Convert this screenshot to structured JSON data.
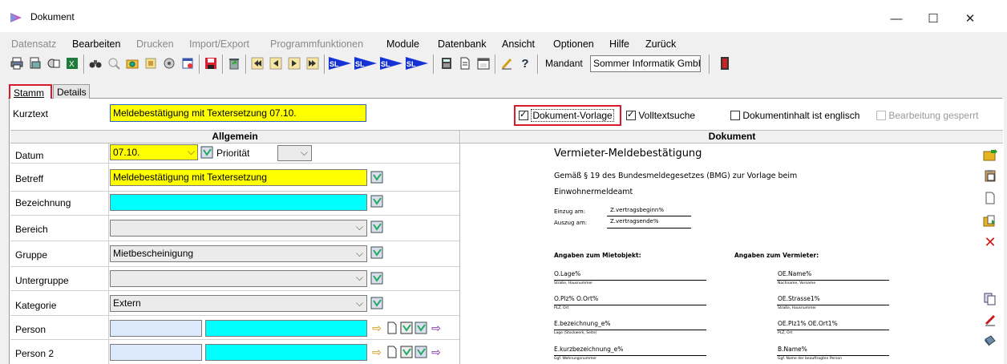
{
  "window": {
    "title": "Dokument",
    "minimize": "—",
    "maximize": "☐",
    "close": "✕"
  },
  "menu": [
    {
      "label": "Datensatz",
      "enabled": false
    },
    {
      "label": "Bearbeiten",
      "enabled": true
    },
    {
      "label": "Drucken",
      "enabled": false
    },
    {
      "label": "Import/Export",
      "enabled": false
    },
    {
      "label": "Programmfunktionen",
      "enabled": false
    },
    {
      "label": "Module",
      "enabled": true
    },
    {
      "label": "Datenbank",
      "enabled": true
    },
    {
      "label": "Ansicht",
      "enabled": true
    },
    {
      "label": "Optionen",
      "enabled": true
    },
    {
      "label": "Hilfe",
      "enabled": true
    },
    {
      "label": "Zurück",
      "enabled": true
    }
  ],
  "toolbar": {
    "mandant_label": "Mandant",
    "mandant_value": "Sommer Informatik GmbH",
    "icons": [
      "print-icon",
      "print-preview-icon",
      "report-icon",
      "excel-icon",
      "binoculars-icon",
      "zoom-icon",
      "search-folder-icon",
      "find-icon",
      "refresh-icon",
      "notes-icon",
      "save-icon",
      "delete-icon",
      "first-record-icon",
      "previous-record-icon",
      "next-record-icon",
      "last-record-icon",
      "sl-blue-1-icon",
      "sl-blue-2-icon",
      "sl-blue-3-icon",
      "sl-blue-4-icon",
      "calculator-icon",
      "document-icon",
      "calendar-icon",
      "edit-icon",
      "help-icon",
      "exit-icon"
    ],
    "sl_label": "SL"
  },
  "tabs": [
    {
      "label": "Stamm",
      "active": true
    },
    {
      "label": "Details",
      "active": false
    }
  ],
  "kurztext": {
    "label": "Kurztext",
    "value": "Meldebestätigung mit Textersetzung  07.10."
  },
  "options": {
    "vorlage": {
      "label": "Dokument-Vorlage",
      "checked": true
    },
    "volltext": {
      "label": "Volltextsuche",
      "checked": true
    },
    "englisch": {
      "label": "Dokumentinhalt ist englisch",
      "checked": false
    },
    "gesperrt": {
      "label": "Bearbeitung gesperrt",
      "checked": false
    }
  },
  "allgemein": {
    "header": "Allgemein",
    "datum": {
      "label": "Datum",
      "value": "07.10.",
      "prio_label": "Priorität"
    },
    "betreff": {
      "label": "Betreff",
      "value": "Meldebestätigung mit Textersetzung"
    },
    "bezeichnung": {
      "label": "Bezeichnung",
      "value": ""
    },
    "bereich": {
      "label": "Bereich",
      "value": ""
    },
    "gruppe": {
      "label": "Gruppe",
      "value": "Mietbescheinigung"
    },
    "untergruppe": {
      "label": "Untergruppe",
      "value": ""
    },
    "kategorie": {
      "label": "Kategorie",
      "value": "Extern"
    },
    "person": {
      "label": "Person"
    },
    "person2": {
      "label": "Person 2"
    }
  },
  "dokument": {
    "header": "Dokument",
    "title": "Vermieter-Meldebestätigung",
    "intro_1": "Gemäß § 19 des Bundesmeldegesetzes (BMG) zur Vorlage beim",
    "intro_2": "Einwohnermeldeamt",
    "einzug_label": "Einzug am:",
    "einzug_value": "Z.vertragsbeginn%",
    "auszug_label": "Auszug am:",
    "auszug_value": "Z.vertragsende%",
    "mietobjekt_heading": "Angaben zum Mietobjekt:",
    "vermieter_heading": "Angaben zum Vermieter:",
    "left_fields": [
      {
        "value": "O.Lage%",
        "caption": "Straße, Hausnummer"
      },
      {
        "value": "O.Plz% O.Ort%",
        "caption": "PLZ, Ort"
      },
      {
        "value": "E.bezeichnung_e%",
        "caption": "Lage (Stockwerk, Seite)"
      },
      {
        "value": "E.kurzbezeichnung_e%",
        "caption": "Ggf. Wohnungsnummer"
      }
    ],
    "right_fields": [
      {
        "value": "OE.Name%",
        "caption": "Nachname, Vorname"
      },
      {
        "value": "OE.Strasse1%",
        "caption": "Straße, Hausnummer"
      },
      {
        "value": "OE.Plz1% OE.Ort1%",
        "caption": "PLZ, Ort"
      },
      {
        "value": "B.Name%",
        "caption": "Ggf. Name der beauftragten Person"
      }
    ]
  }
}
